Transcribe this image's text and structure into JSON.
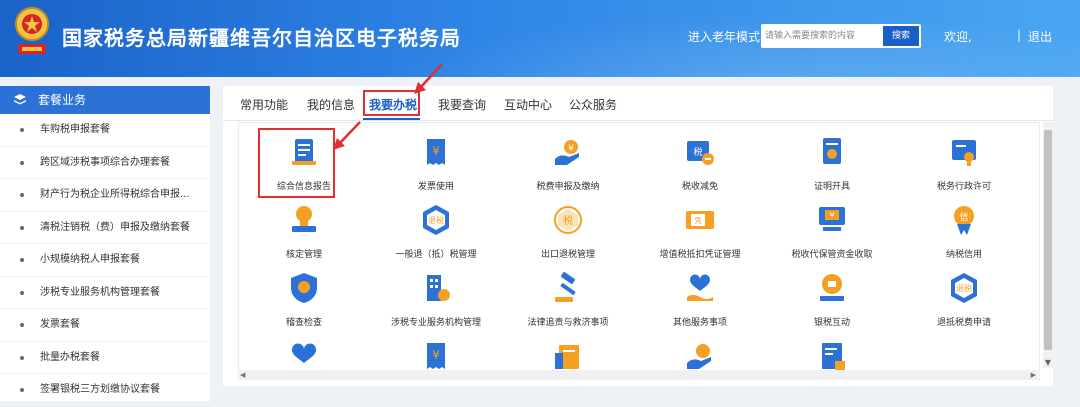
{
  "header": {
    "title": "国家税务总局新疆维吾尔自治区电子税务局",
    "old_mode": "进入老年模式",
    "search_placeholder": "请输入需要搜索的内容",
    "search_button": "搜索",
    "welcome": "欢迎,",
    "separator": "|",
    "logout": "退出"
  },
  "sidebar": {
    "heading": "套餐业务",
    "items": [
      "车购税申报套餐",
      "跨区域涉税事项综合办理套餐",
      "财产行为税企业所得税综合申报...",
      "清税注销税（费）申报及缴纳套餐",
      "小规模纳税人申报套餐",
      "涉税专业服务机构管理套餐",
      "发票套餐",
      "批量办税套餐",
      "签署银税三方划缴协议套餐"
    ]
  },
  "tabs": [
    "常用功能",
    "我的信息",
    "我要办税",
    "我要查询",
    "互动中心",
    "公众服务"
  ],
  "grid": [
    "综合信息报告",
    "发票使用",
    "税费申报及缴纳",
    "税收减免",
    "证明开具",
    "税务行政许可",
    "核定管理",
    "一般退（抵）税管理",
    "出口退税管理",
    "增值税抵扣凭证管理",
    "税收代保管资金收取",
    "纳税信用",
    "稽查检查",
    "涉税专业服务机构管理",
    "法律追责与救济事项",
    "其他服务事项",
    "银税互动",
    "退抵税费申请",
    "",
    "",
    "",
    "",
    ""
  ],
  "colors": {
    "primary": "#1a5fc7",
    "highlight": "#e03030",
    "icon_orange": "#f3a023"
  }
}
